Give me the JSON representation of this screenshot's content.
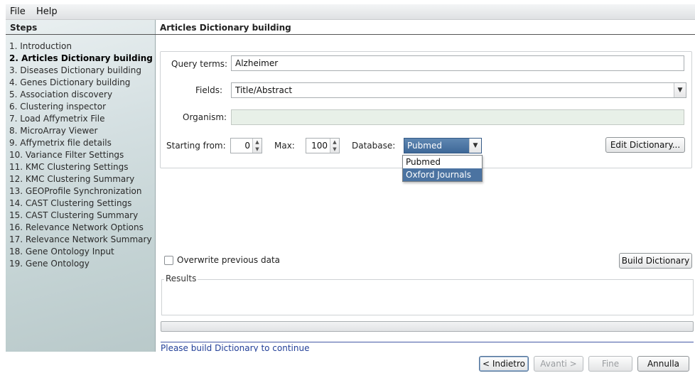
{
  "menu": {
    "file": "File",
    "help": "Help"
  },
  "sidebar": {
    "title": "Steps",
    "steps": [
      "1. Introduction",
      "2. Articles Dictionary building",
      "3. Diseases Dictionary building",
      "4. Genes Dictionary building",
      "5. Association discovery",
      "6. Clustering inspector",
      "7. Load Affymetrix File",
      "8. MicroArray Viewer",
      "9. Affymetrix file details",
      "10. Variance Filter Settings",
      "11. KMC Clustering Settings",
      "12. KMC Clustering Summary",
      "13. GEOProfile Synchronization",
      "14. CAST Clustering Settings",
      "15. CAST Clustering Summary",
      "16. Relevance Network Options",
      "17. Relevance Network Summary",
      "18. Gene Ontology Input",
      "19. Gene Ontology"
    ],
    "active_index": 1
  },
  "main": {
    "title": "Articles Dictionary building",
    "query_terms_label": "Query terms:",
    "query_terms_value": "Alzheimer",
    "fields_label": "Fields:",
    "fields_value": "Title/Abstract",
    "organism_label": "Organism:",
    "organism_value": "",
    "starting_from_label": "Starting from:",
    "starting_from_value": "0",
    "max_label": "Max:",
    "max_value": "100",
    "database_label": "Database:",
    "database_value": "Pubmed",
    "database_options": [
      "Pubmed",
      "Oxford Journals"
    ],
    "database_highlighted": "Oxford Journals",
    "edit_dictionary": "Edit Dictionary...",
    "overwrite_label": "Overwrite previous data",
    "overwrite_checked": false,
    "build_dictionary": "Build Dictionary",
    "results_label": "Results",
    "status": "Please build Dictionary to continue"
  },
  "footer": {
    "back": "< Indietro",
    "next": "Avanti >",
    "finish": "Fine",
    "cancel": "Annulla"
  },
  "icons": {
    "combo_arrow": "chevron-down-icon",
    "spinner": "spinner-arrows-icon"
  }
}
